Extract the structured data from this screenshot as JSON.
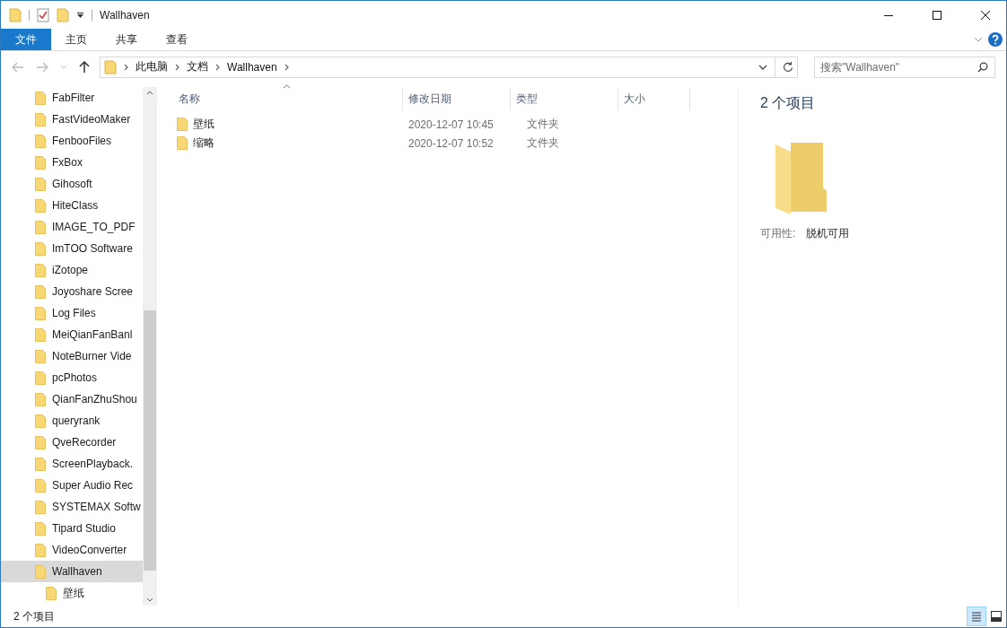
{
  "window": {
    "title": "Wallhaven"
  },
  "ribbon_tabs": [
    {
      "label": "文件",
      "selected": true
    },
    {
      "label": "主页",
      "selected": false
    },
    {
      "label": "共享",
      "selected": false
    },
    {
      "label": "查看",
      "selected": false
    }
  ],
  "navigation": {
    "back_disabled": true,
    "forward_disabled": true
  },
  "breadcrumbs": [
    "此电脑",
    "文档",
    "Wallhaven"
  ],
  "search": {
    "placeholder": "搜索\"Wallhaven\""
  },
  "sidebar": {
    "items": [
      {
        "label": "FabFilter",
        "selected": false
      },
      {
        "label": "FastVideoMaker",
        "selected": false
      },
      {
        "label": "FenbooFiles",
        "selected": false
      },
      {
        "label": "FxBox",
        "selected": false
      },
      {
        "label": "Gihosoft",
        "selected": false
      },
      {
        "label": "HiteClass",
        "selected": false
      },
      {
        "label": "IMAGE_TO_PDF",
        "selected": false
      },
      {
        "label": "ImTOO Software",
        "selected": false
      },
      {
        "label": "iZotope",
        "selected": false
      },
      {
        "label": "Joyoshare Scree",
        "selected": false
      },
      {
        "label": "Log Files",
        "selected": false
      },
      {
        "label": "MeiQianFanBanl",
        "selected": false
      },
      {
        "label": "NoteBurner Vide",
        "selected": false
      },
      {
        "label": "pcPhotos",
        "selected": false
      },
      {
        "label": "QianFanZhuShou",
        "selected": false
      },
      {
        "label": "queryrank",
        "selected": false
      },
      {
        "label": "QveRecorder",
        "selected": false
      },
      {
        "label": "ScreenPlayback.",
        "selected": false
      },
      {
        "label": "Super Audio Rec",
        "selected": false
      },
      {
        "label": "SYSTEMAX Softw",
        "selected": false
      },
      {
        "label": "Tipard Studio",
        "selected": false
      },
      {
        "label": "VideoConverter",
        "selected": false
      },
      {
        "label": "Wallhaven",
        "selected": true,
        "children": [
          {
            "label": "壁纸",
            "selected": false
          }
        ]
      }
    ]
  },
  "table": {
    "columns": [
      "名称",
      "修改日期",
      "类型",
      "大小"
    ],
    "rows": [
      {
        "name": "壁纸",
        "modified": "2020-12-07 10:45",
        "type": "文件夹"
      },
      {
        "name": "缩略",
        "modified": "2020-12-07 10:52",
        "type": "文件夹"
      }
    ]
  },
  "details_pane": {
    "title": "2 个项目",
    "availability_label": "可用性:",
    "availability_value": "脱机可用"
  },
  "status_bar": {
    "text": "2 个项目",
    "views": [
      {
        "kind": "details",
        "selected": true
      },
      {
        "kind": "large_icons",
        "selected": false
      }
    ]
  }
}
